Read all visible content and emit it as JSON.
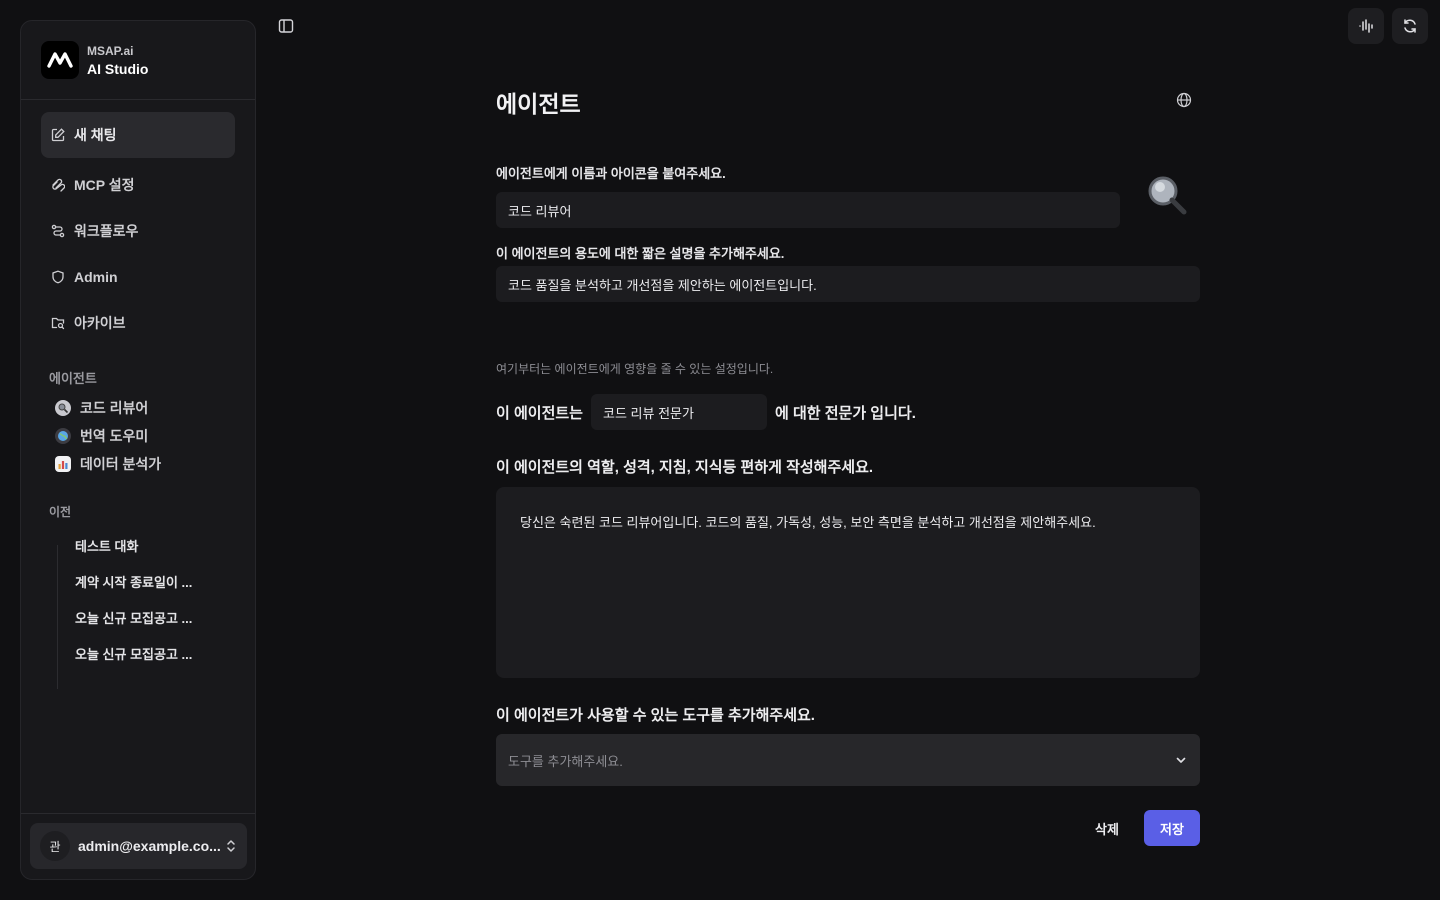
{
  "brand": {
    "company": "MSAP.ai",
    "product": "AI Studio"
  },
  "nav": [
    {
      "label": "새 채팅",
      "icon": "edit-icon",
      "active": true
    },
    {
      "label": "MCP 설정",
      "icon": "mcp-icon"
    },
    {
      "label": "워크플로우",
      "icon": "workflow-icon"
    },
    {
      "label": "Admin",
      "icon": "shield-icon"
    },
    {
      "label": "아카이브",
      "icon": "archive-folder-icon"
    }
  ],
  "agents_section": {
    "label": "에이전트",
    "items": [
      {
        "label": "코드 리뷰어",
        "icon": "magnifier-icon"
      },
      {
        "label": "번역 도우미",
        "icon": "globe-icon"
      },
      {
        "label": "데이터 분석가",
        "icon": "bar-chart-icon"
      }
    ]
  },
  "history_section": {
    "label": "이전",
    "items": [
      "테스트 대화",
      "계약 시작 종료일이 ...",
      "오늘 신규 모집공고 ...",
      "오늘 신규 모집공고 ..."
    ]
  },
  "user": {
    "avatar": "관",
    "email": "admin@example.co..."
  },
  "main": {
    "title": "에이전트",
    "name_label": "에이전트에게 이름과 아이콘을 붙여주세요.",
    "name_value": "코드 리뷰어",
    "desc_label": "이 에이전트의 용도에 대한 짧은 설명을 추가해주세요.",
    "desc_value": "코드 품질을 분석하고 개선점을 제안하는 에이전트입니다.",
    "hint": "여기부터는 에이전트에게 영향을 줄 수 있는 설정입니다.",
    "expert_prefix": "이 에이전트는",
    "expert_value": "코드 리뷰 전문가",
    "expert_suffix": "에 대한 전문가 입니다.",
    "prompt_label": "이 에이전트의 역할, 성격, 지침, 지식등 편하게 작성해주세요.",
    "prompt_value": "당신은 숙련된 코드 리뷰어입니다. 코드의 품질, 가독성, 성능, 보안 측면을 분석하고 개선점을 제안해주세요.",
    "tools_label": "이 에이전트가 사용할 수 있는 도구를 추가해주세요.",
    "tools_placeholder": "도구를 추가해주세요.",
    "delete_label": "삭제",
    "save_label": "저장"
  },
  "colors": {
    "accent": "#5a5fe6",
    "background": "#101012",
    "sidebar": "#18181b"
  }
}
